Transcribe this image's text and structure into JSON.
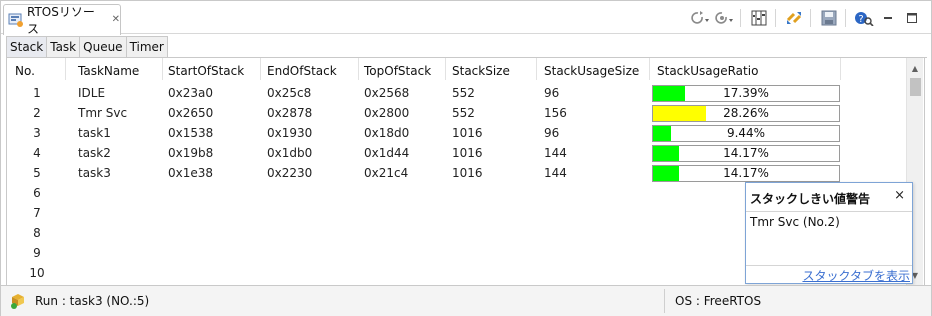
{
  "view": {
    "title": "RTOSリソース",
    "close_glyph": "✕",
    "tab_icon": "rtos-resource-icon",
    "toolbar_icons": [
      "refresh-dropdown-icon",
      "refresh-settings-dropdown-icon",
      "table-columns-icon",
      "sync-icon",
      "save-icon",
      "help-icon",
      "minimize-icon",
      "maximize-icon"
    ]
  },
  "subtabs": [
    "Stack",
    "Task",
    "Queue",
    "Timer"
  ],
  "active_subtab": "Stack",
  "table": {
    "columns": [
      "No.",
      "TaskName",
      "StartOfStack",
      "EndOfStack",
      "TopOfStack",
      "StackSize",
      "StackUsageSize",
      "StackUsageRatio"
    ],
    "rows": [
      {
        "no": "1",
        "name": "IDLE",
        "start": "0x23a0",
        "end": "0x25c8",
        "top": "0x2568",
        "size": "552",
        "usage": "96",
        "ratio_text": "17.39%",
        "ratio": 0.1739,
        "color": "#00ff00"
      },
      {
        "no": "2",
        "name": "Tmr Svc",
        "start": "0x2650",
        "end": "0x2878",
        "top": "0x2800",
        "size": "552",
        "usage": "156",
        "ratio_text": "28.26%",
        "ratio": 0.2826,
        "color": "#ffff00"
      },
      {
        "no": "3",
        "name": "task1",
        "start": "0x1538",
        "end": "0x1930",
        "top": "0x18d0",
        "size": "1016",
        "usage": "96",
        "ratio_text": "9.44%",
        "ratio": 0.0944,
        "color": "#00ff00"
      },
      {
        "no": "4",
        "name": "task2",
        "start": "0x19b8",
        "end": "0x1db0",
        "top": "0x1d44",
        "size": "1016",
        "usage": "144",
        "ratio_text": "14.17%",
        "ratio": 0.1417,
        "color": "#00ff00"
      },
      {
        "no": "5",
        "name": "task3",
        "start": "0x1e38",
        "end": "0x2230",
        "top": "0x21c4",
        "size": "1016",
        "usage": "144",
        "ratio_text": "14.17%",
        "ratio": 0.1417,
        "color": "#00ff00"
      },
      {
        "no": "6"
      },
      {
        "no": "7"
      },
      {
        "no": "8"
      },
      {
        "no": "9"
      },
      {
        "no": "10"
      }
    ]
  },
  "popup": {
    "title": "スタックしきい値警告",
    "close_glyph": "×",
    "message": "Tmr Svc (No.2)",
    "link": "スタックタブを表示"
  },
  "status": {
    "run": "Run : task3 (NO.:5)",
    "os": "OS : FreeRTOS"
  }
}
